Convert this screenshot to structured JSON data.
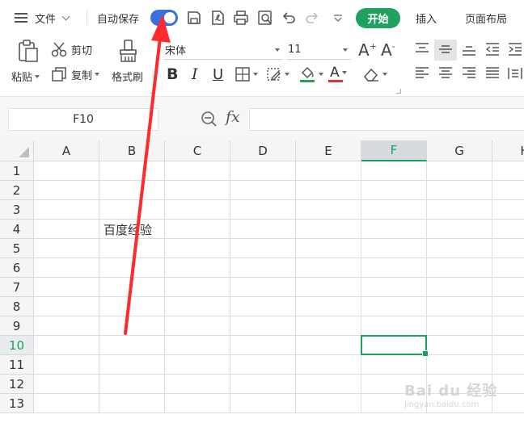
{
  "menubar": {
    "file_label": "文件",
    "autosave_label": "自动保存",
    "autosave_on": true,
    "quick_icons": [
      "save-icon",
      "export-pdf-icon",
      "print-icon",
      "print-preview-icon",
      "undo-icon",
      "redo-icon",
      "more-dropdown-icon"
    ],
    "tabs": [
      {
        "label": "开始",
        "active": true
      },
      {
        "label": "插入",
        "active": false
      },
      {
        "label": "页面布局",
        "active": false
      }
    ]
  },
  "ribbon": {
    "paste_label": "粘贴",
    "cut_label": "剪切",
    "copy_label": "复制",
    "format_painter_label": "格式刷",
    "font_name": "宋体",
    "font_size": "11",
    "bold": "B",
    "italic": "I",
    "underline": "U",
    "font_color": "A",
    "grow_font": "A",
    "shrink_font": "A"
  },
  "formula_bar": {
    "cell_ref": "F10",
    "fx": "fx",
    "content": ""
  },
  "sheet": {
    "columns": [
      "A",
      "B",
      "C",
      "D",
      "E",
      "F",
      "G",
      "H"
    ],
    "rows": [
      "1",
      "2",
      "3",
      "4",
      "5",
      "6",
      "7",
      "8",
      "9",
      "10",
      "11",
      "12",
      "13"
    ],
    "selected_cell": "F10",
    "cells": [
      {
        "ref": "B4",
        "value": "百度经验"
      }
    ]
  },
  "watermark": {
    "brand": "Bai du 经验",
    "url": "jingyan.baidu.com"
  },
  "colors": {
    "accent_green": "#20a160",
    "toggle_blue": "#3b6fe0",
    "annotation_red": "#ff2b2b",
    "font_color_red": "#e03030",
    "fill_green": "#2aa050"
  }
}
